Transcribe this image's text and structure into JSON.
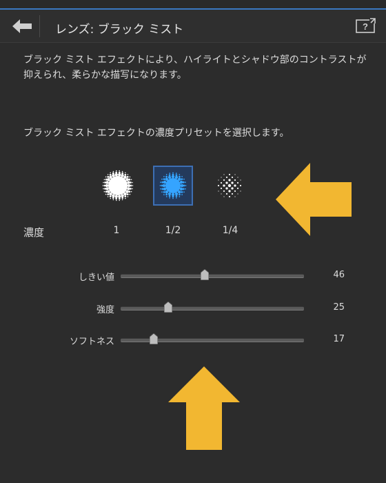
{
  "header": {
    "title": "レンズ: ブラック ミスト"
  },
  "description": "ブラック ミスト エフェクトにより、ハイライトとシャドウ部のコントラストが抑えられ、柔らかな描写になります。",
  "preset_label": "ブラック ミスト エフェクトの濃度プリセットを選択します。",
  "density": {
    "label": "濃度",
    "presets": [
      {
        "label": "1",
        "selected": false,
        "icon": "mist-dense-icon"
      },
      {
        "label": "1/2",
        "selected": true,
        "icon": "mist-half-icon"
      },
      {
        "label": "1/4",
        "selected": false,
        "icon": "mist-quarter-icon"
      }
    ]
  },
  "sliders": [
    {
      "label": "しきい値",
      "value": "46",
      "fraction": 0.46
    },
    {
      "label": "強度",
      "value": "25",
      "fraction": 0.26
    },
    {
      "label": "ソフトネス",
      "value": "17",
      "fraction": 0.18
    }
  ],
  "colors": {
    "accent": "#3d6fb4",
    "selected_icon": "#35a4ff",
    "annotation_arrow": "#f2b731"
  }
}
